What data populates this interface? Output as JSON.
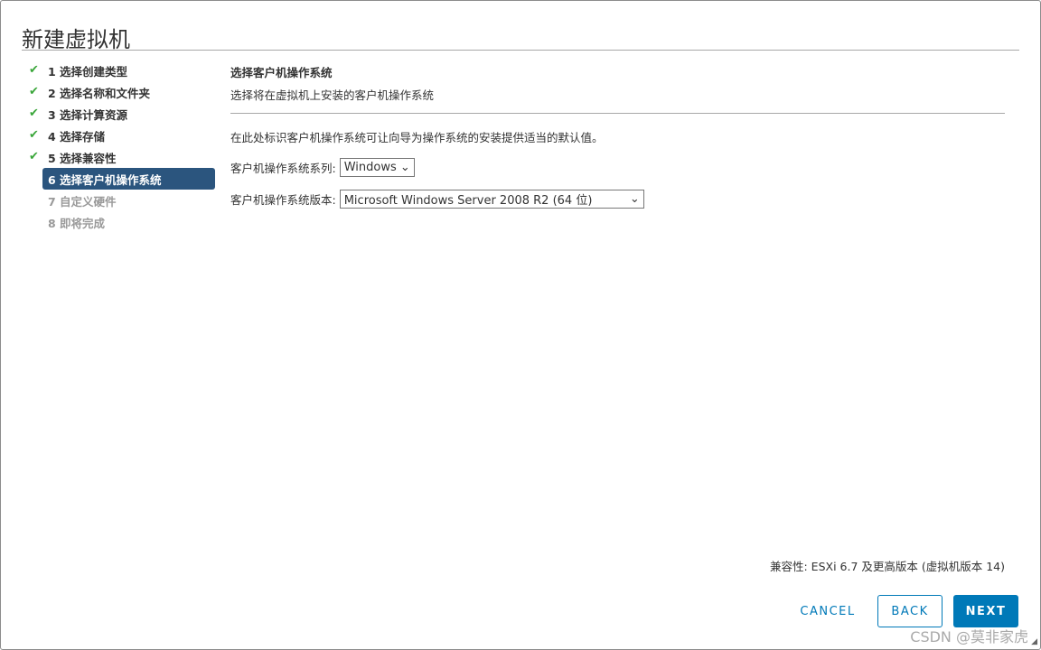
{
  "title": "新建虚拟机",
  "steps": [
    {
      "label": "1 选择创建类型",
      "state": "done"
    },
    {
      "label": "2 选择名称和文件夹",
      "state": "done"
    },
    {
      "label": "3 选择计算资源",
      "state": "done"
    },
    {
      "label": "4 选择存储",
      "state": "done"
    },
    {
      "label": "5 选择兼容性",
      "state": "done"
    },
    {
      "label": "6 选择客户机操作系统",
      "state": "active"
    },
    {
      "label": "7 自定义硬件",
      "state": "pending"
    },
    {
      "label": "8 即将完成",
      "state": "pending"
    }
  ],
  "main": {
    "heading": "选择客户机操作系统",
    "subheading": "选择将在虚拟机上安装的客户机操作系统",
    "description": "在此处标识客户机操作系统可让向导为操作系统的安装提供适当的默认值。",
    "family_label": "客户机操作系统系列:",
    "family_value": "Windows",
    "version_label": "客户机操作系统版本:",
    "version_value": "Microsoft Windows Server 2008 R2 (64 位)"
  },
  "compat": "兼容性: ESXi 6.7 及更高版本 (虚拟机版本 14)",
  "buttons": {
    "cancel": "CANCEL",
    "back": "BACK",
    "next": "NEXT"
  },
  "watermark": "CSDN @莫非家虎",
  "check": "✔"
}
